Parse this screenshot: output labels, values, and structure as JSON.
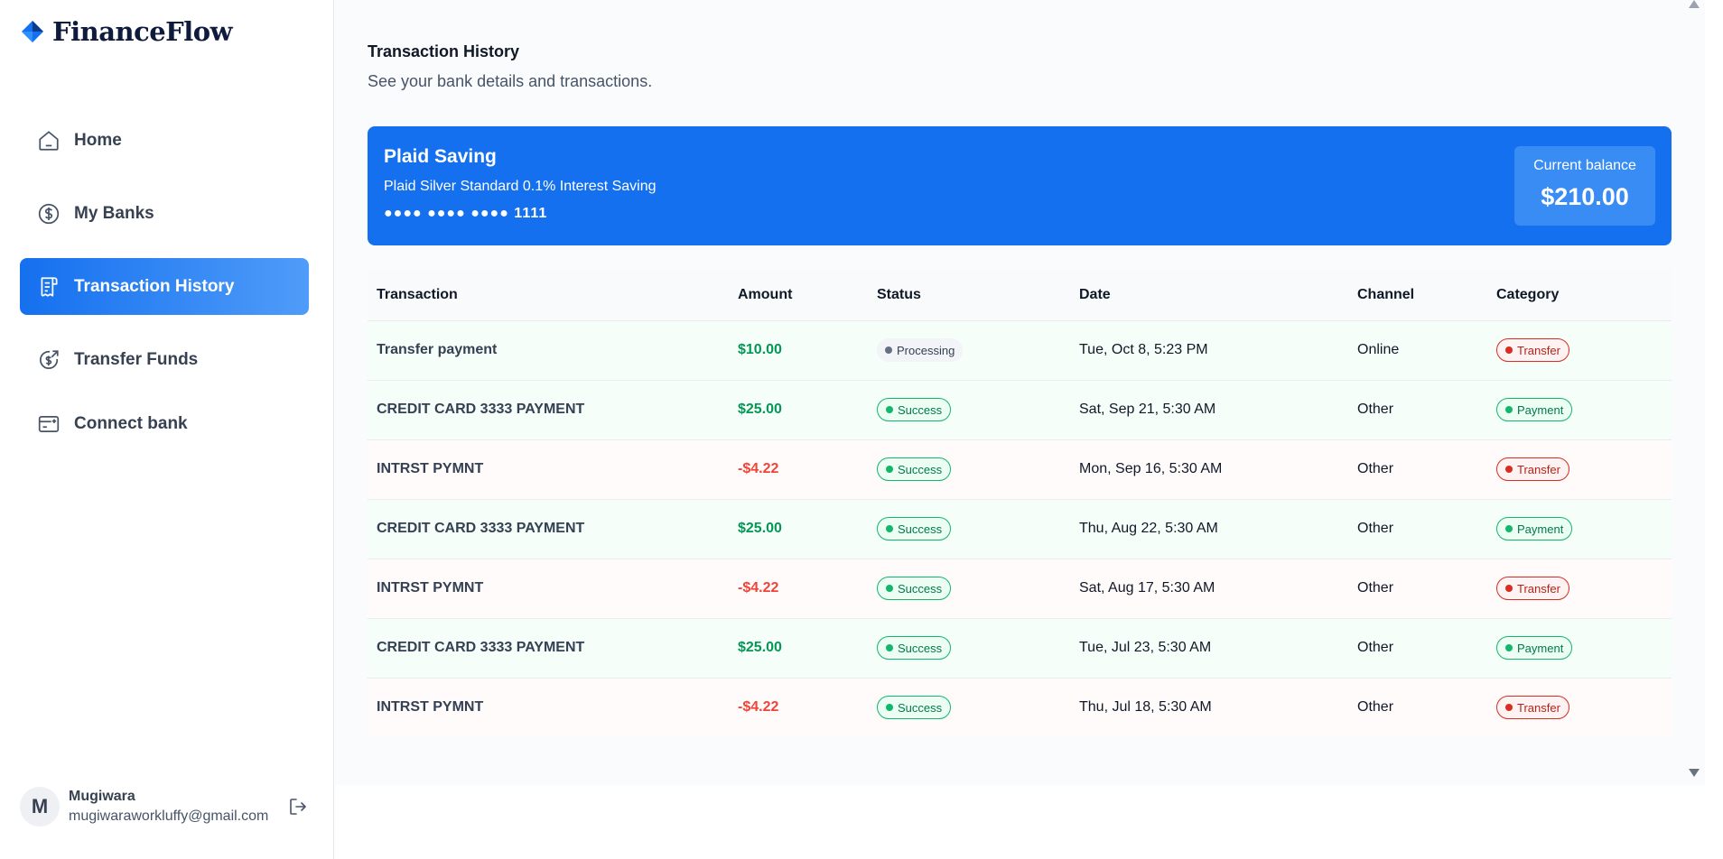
{
  "brand": {
    "name": "FinanceFlow",
    "logo_icon": "diamond-logo-icon"
  },
  "sidebar": {
    "items": [
      {
        "label": "Home",
        "icon": "home-icon"
      },
      {
        "label": "My Banks",
        "icon": "dollar-circle-icon"
      },
      {
        "label": "Transaction History",
        "icon": "receipt-icon",
        "active": true
      },
      {
        "label": "Transfer Funds",
        "icon": "transfer-dollar-icon"
      },
      {
        "label": "Connect bank",
        "icon": "add-bank-card-icon"
      }
    ],
    "user": {
      "initial": "M",
      "name": "Mugiwara",
      "email": "mugiwaraworkluffy@gmail.com"
    }
  },
  "header": {
    "title": "Transaction History",
    "subtitle": "See your bank details and transactions."
  },
  "bank_card": {
    "name": "Plaid Saving",
    "official_name": "Plaid Silver Standard 0.1% Interest Saving",
    "mask": "●●●● ●●●● ●●●● 1111",
    "balance_label": "Current balance",
    "balance": "$210.00",
    "color": "#1570ef"
  },
  "table": {
    "columns": [
      "Transaction",
      "Amount",
      "Status",
      "Date",
      "Channel",
      "Category"
    ],
    "rows": [
      {
        "name": "Transfer payment",
        "amount": "$10.00",
        "status": "Processing",
        "date": "Tue, Oct 8, 5:23 PM",
        "channel": "Online",
        "category": "Transfer"
      },
      {
        "name": "CREDIT CARD 3333 PAYMENT",
        "amount": "$25.00",
        "status": "Success",
        "date": "Sat, Sep 21, 5:30 AM",
        "channel": "Other",
        "category": "Payment"
      },
      {
        "name": "INTRST PYMNT",
        "amount": "-$4.22",
        "status": "Success",
        "date": "Mon, Sep 16, 5:30 AM",
        "channel": "Other",
        "category": "Transfer"
      },
      {
        "name": "CREDIT CARD 3333 PAYMENT",
        "amount": "$25.00",
        "status": "Success",
        "date": "Thu, Aug 22, 5:30 AM",
        "channel": "Other",
        "category": "Payment"
      },
      {
        "name": "INTRST PYMNT",
        "amount": "-$4.22",
        "status": "Success",
        "date": "Sat, Aug 17, 5:30 AM",
        "channel": "Other",
        "category": "Transfer"
      },
      {
        "name": "CREDIT CARD 3333 PAYMENT",
        "amount": "$25.00",
        "status": "Success",
        "date": "Tue, Jul 23, 5:30 AM",
        "channel": "Other",
        "category": "Payment"
      },
      {
        "name": "INTRST PYMNT",
        "amount": "-$4.22",
        "status": "Success",
        "date": "Thu, Jul 18, 5:30 AM",
        "channel": "Other",
        "category": "Transfer"
      }
    ]
  },
  "colors": {
    "accent": "#1570ef",
    "positive": "#039855",
    "negative": "#f04438"
  }
}
